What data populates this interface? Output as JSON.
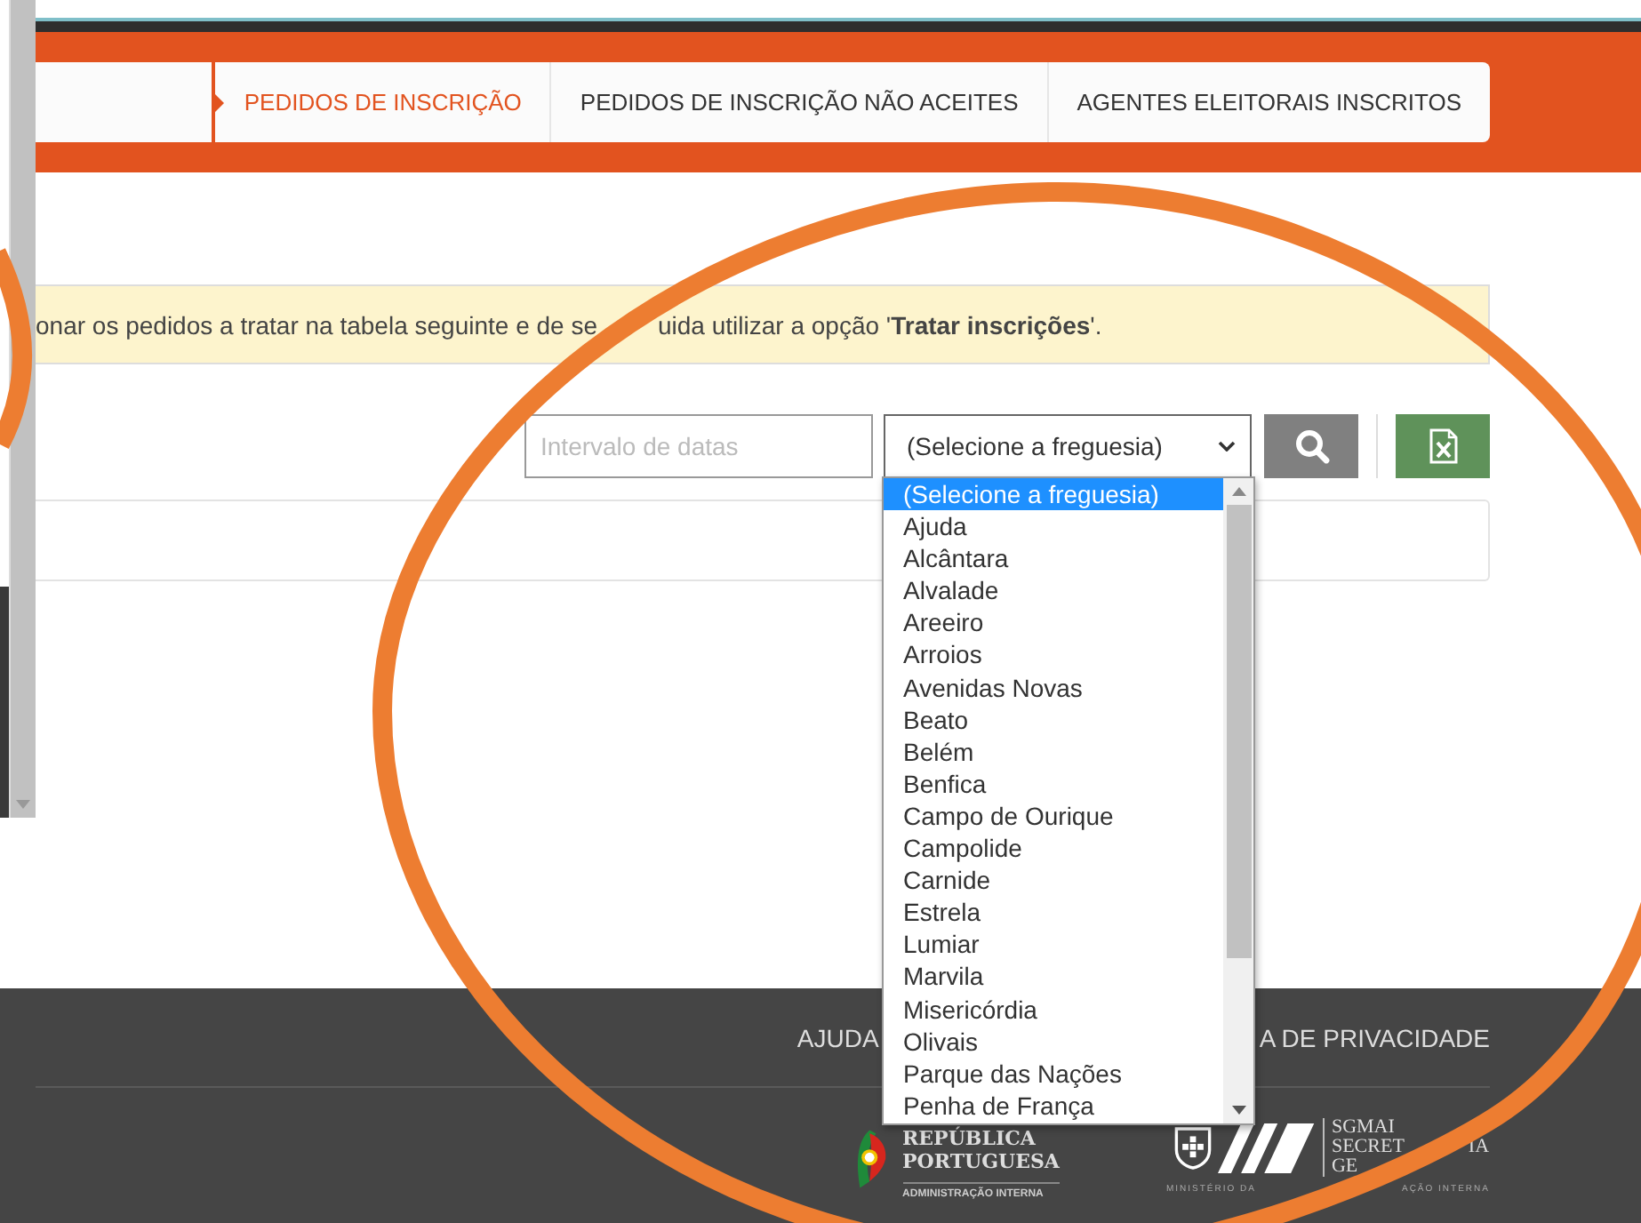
{
  "tabs": [
    {
      "label": "PEDIDOS DE INSCRIÇÃO",
      "selected": true
    },
    {
      "label": "PEDIDOS DE INSCRIÇÃO NÃO ACEITES",
      "selected": false
    },
    {
      "label": "AGENTES ELEITORAIS INSCRITOS",
      "selected": false
    }
  ],
  "notice": [
    "onar os pedidos a tratar na tabela seguinte e de se",
    "uida utilizar a opção '**Tratar inscrições**'."
  ],
  "filters": {
    "date_range": {
      "placeholder": "Intervalo de datas"
    },
    "parish_select": {
      "value": "(Selecione a freguesia)",
      "expanded": true
    }
  },
  "parish_options": [
    {
      "label": "(Selecione a freguesia)",
      "selected": true
    },
    {
      "label": "Ajuda",
      "selected": false
    },
    {
      "label": "Alcântara",
      "selected": false
    },
    {
      "label": "Alvalade",
      "selected": false
    },
    {
      "label": "Areeiro",
      "selected": false
    },
    {
      "label": "Arroios",
      "selected": false
    },
    {
      "label": "Avenidas Novas",
      "selected": false
    },
    {
      "label": "Beato",
      "selected": false
    },
    {
      "label": "Belém",
      "selected": false
    },
    {
      "label": "Benfica",
      "selected": false
    },
    {
      "label": "Campo de Ourique",
      "selected": false
    },
    {
      "label": "Campolide",
      "selected": false
    },
    {
      "label": "Carnide",
      "selected": false
    },
    {
      "label": "Estrela",
      "selected": false
    },
    {
      "label": "Lumiar",
      "selected": false
    },
    {
      "label": "Marvila",
      "selected": false
    },
    {
      "label": "Misericórdia",
      "selected": false
    },
    {
      "label": "Olivais",
      "selected": false
    },
    {
      "label": "Parque das Nações",
      "selected": false
    },
    {
      "label": "Penha de França",
      "selected": false
    }
  ],
  "footer": {
    "links": [
      "AJUDA",
      "A DE PRIVACIDADE"
    ],
    "republica_logo": {
      "lines": [
        "REPÚBLICA",
        "PORTUGUESA"
      ],
      "subtitle": "ADMINISTRAÇÃO INTERNA"
    },
    "sgmai_logo": {
      "lines": [
        [
          "SGMAI"
        ],
        [
          "SECRET",
          "IA"
        ],
        [
          "GE"
        ]
      ],
      "subtitle": [
        "MINISTÉRIO DA",
        "AÇÃO INTERNA"
      ]
    }
  }
}
